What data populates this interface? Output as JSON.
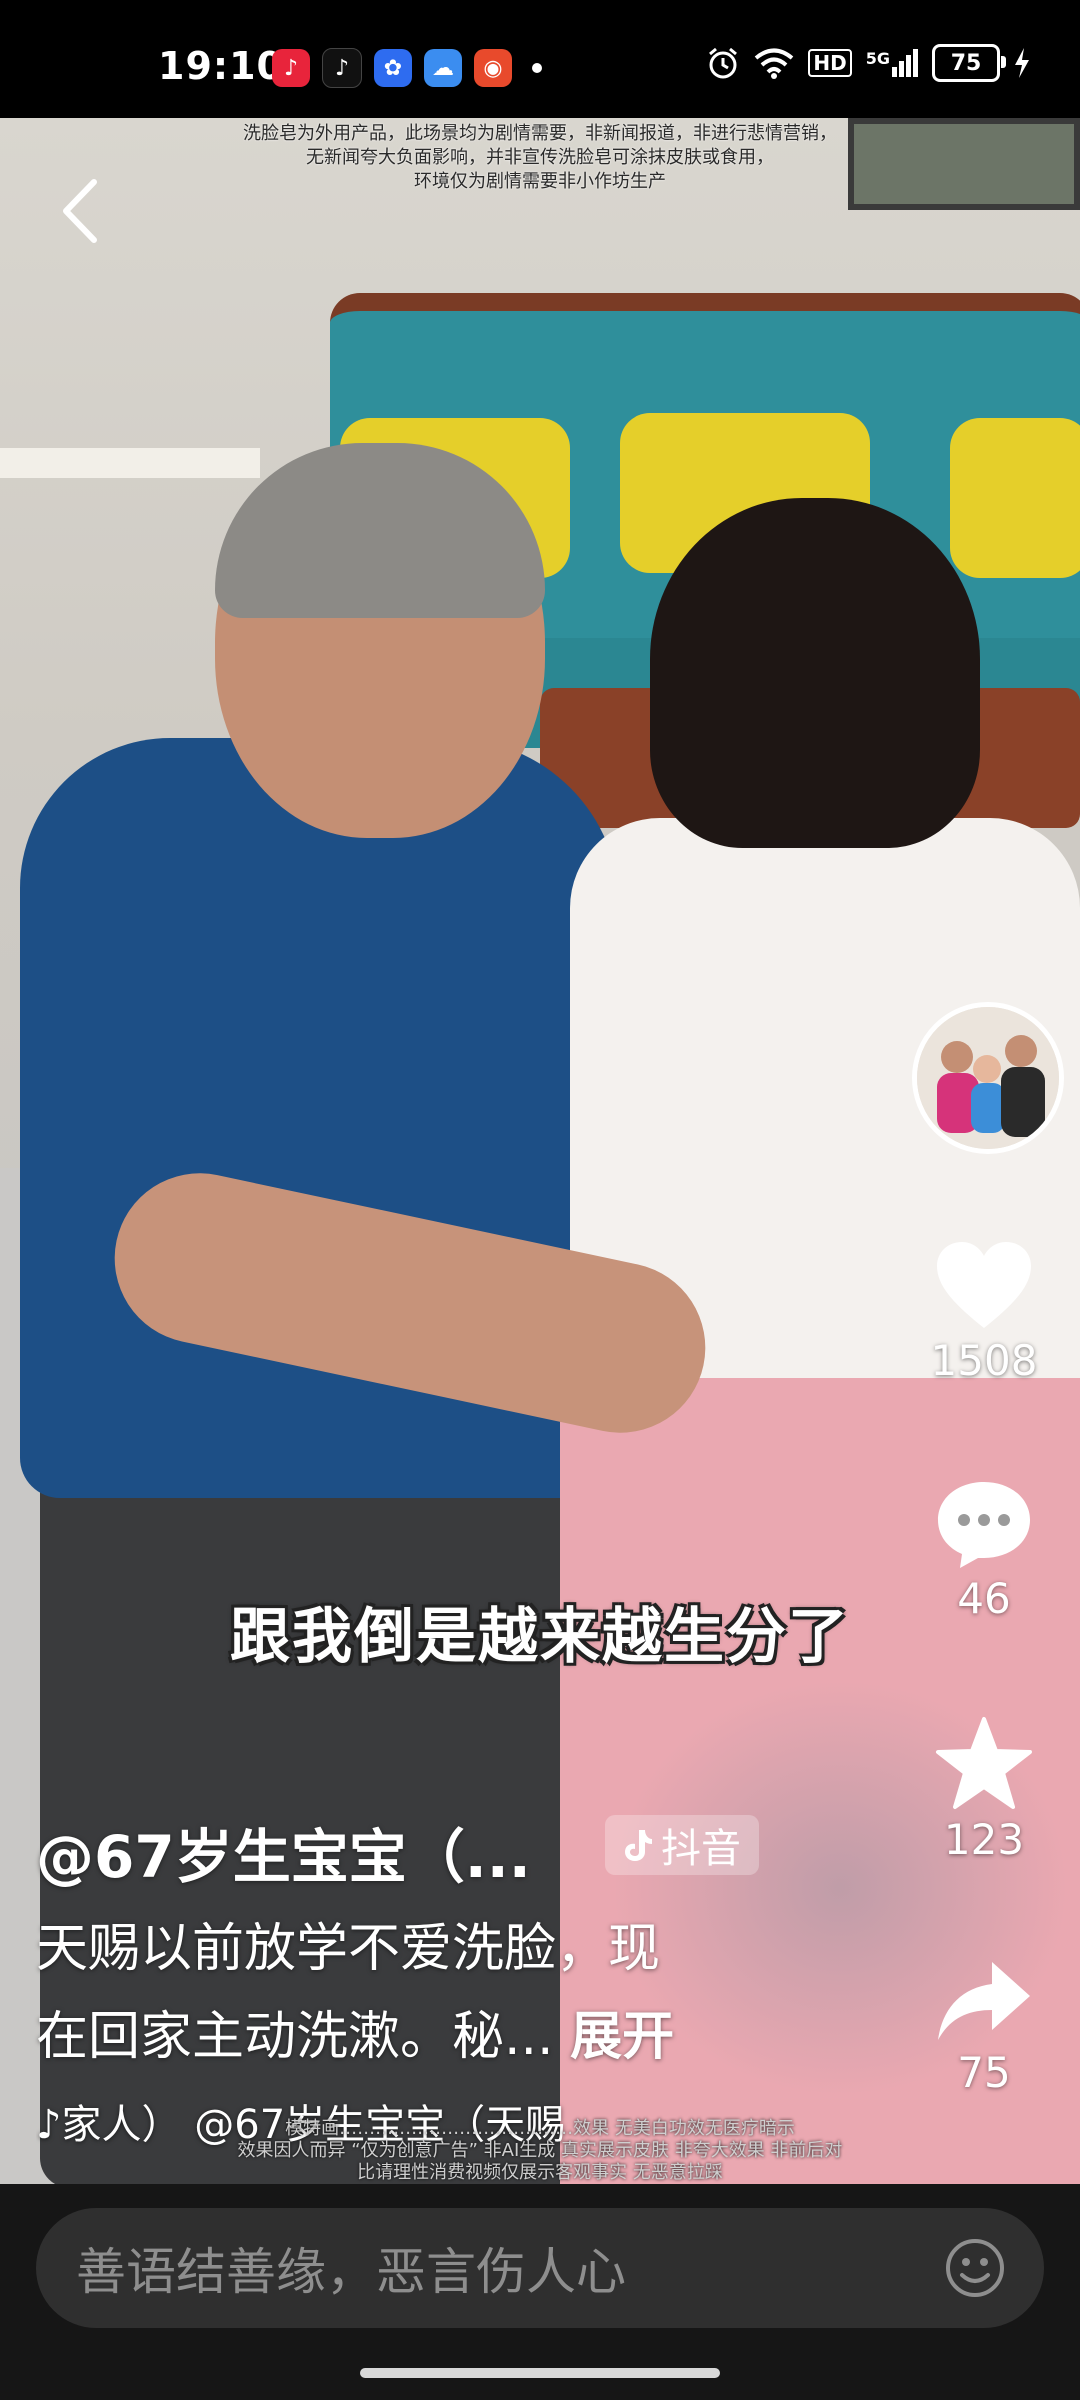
{
  "status_bar": {
    "time": "19:10",
    "apps": [
      {
        "icon": "music-app-icon",
        "color": "#e8243b"
      },
      {
        "icon": "douyin-app-icon",
        "color": "#111111"
      },
      {
        "icon": "baidu-app-icon",
        "color": "#2e6cf0"
      },
      {
        "icon": "weather-app-icon",
        "color": "#3b8df0"
      },
      {
        "icon": "camera-app-icon",
        "color": "#e84a2c"
      }
    ],
    "network_hd": "HD",
    "network_5g": "5G",
    "battery": "75"
  },
  "video": {
    "disclaimer_top": [
      "洗脸皂为外用产品，此场景均为剧情需要，非新闻报道，非进行悲情营销，",
      "无新闻夸大负面影响，并非宣传洗脸皂可涂抹皮肤或食用，",
      "环境仅为剧情需要非小作坊生产"
    ],
    "subtitle": "跟我倒是越来越生分了",
    "disclaimer_bottom": [
      "模特画…………………………………效果 无美白功效无医疗暗示",
      "效果因人而异 “仅为创意广告” 非AI生成 真实展示皮肤 非夸大效果 非前后对",
      "比请理性消费视频仅展示客观事实 无恶意拉踩"
    ]
  },
  "actions": {
    "likes": "1508",
    "comments": "46",
    "favorites": "123",
    "shares": "75"
  },
  "info": {
    "author": "@67岁生宝宝（...",
    "platform_badge": "抖音",
    "description_line1": "天赐以前放学不爱洗脸，现",
    "description_line2": "在回家主动洗漱。秘...",
    "expand": "展开",
    "music": "家人） @67岁生宝宝（天赐"
  },
  "comment_bar": {
    "placeholder": "善语结善缘，恶言伤人心"
  }
}
